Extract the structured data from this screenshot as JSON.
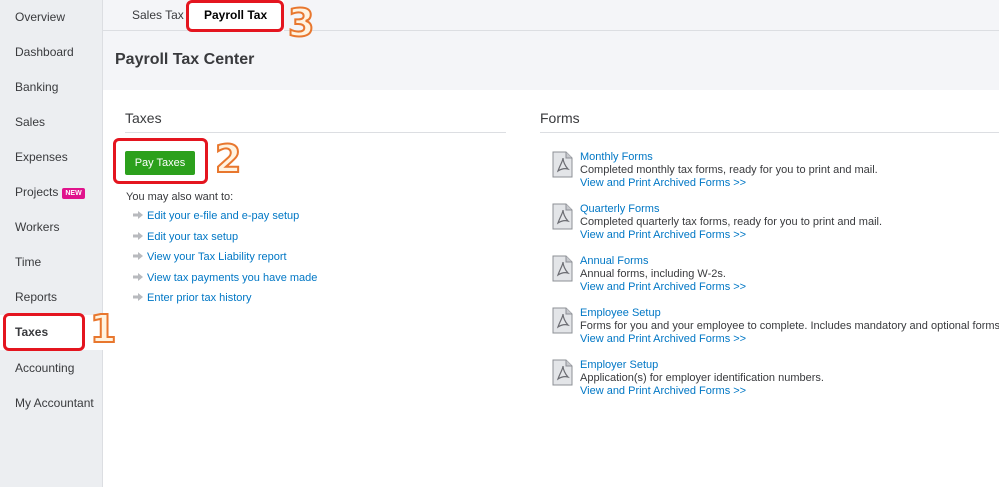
{
  "sidebar": {
    "items": [
      {
        "label": "Overview"
      },
      {
        "label": "Dashboard"
      },
      {
        "label": "Banking"
      },
      {
        "label": "Sales"
      },
      {
        "label": "Expenses"
      },
      {
        "label": "Projects",
        "badge": "NEW"
      },
      {
        "label": "Workers"
      },
      {
        "label": "Time"
      },
      {
        "label": "Reports"
      },
      {
        "label": "Taxes",
        "active": true
      },
      {
        "label": "Accounting"
      },
      {
        "label": "My Accountant"
      }
    ]
  },
  "tabs": [
    {
      "label": "Sales Tax"
    },
    {
      "label": "Payroll Tax",
      "active": true
    }
  ],
  "page": {
    "title": "Payroll Tax Center"
  },
  "taxes": {
    "title": "Taxes",
    "pay_button": "Pay Taxes",
    "also_label": "You may also want to:",
    "links": [
      "Edit your e-file and e-pay setup",
      "Edit your tax setup",
      "View your Tax Liability report",
      "View tax payments you have made",
      "Enter prior tax history"
    ]
  },
  "forms": {
    "title": "Forms",
    "items": [
      {
        "title": "Monthly Forms",
        "desc": "Completed monthly tax forms, ready for you to print and mail.",
        "link": "View and Print Archived Forms >>"
      },
      {
        "title": "Quarterly Forms",
        "desc": "Completed quarterly tax forms, ready for you to print and mail.",
        "link": "View and Print Archived Forms >>"
      },
      {
        "title": "Annual Forms",
        "desc": "Annual forms, including W-2s.",
        "link": "View and Print Archived Forms >>"
      },
      {
        "title": "Employee Setup",
        "desc": "Forms for you and your employee to complete. Includes mandatory and optional forms.",
        "link": "View and Print Archived Forms >>"
      },
      {
        "title": "Employer Setup",
        "desc": "Application(s) for employer identification numbers.",
        "link": "View and Print Archived Forms >>"
      }
    ]
  },
  "annotations": {
    "n1": "1",
    "n2": "2",
    "n3": "3"
  },
  "colors": {
    "accent_green": "#2ca01c",
    "link_blue": "#0077c5",
    "highlight_red": "#e4151f",
    "badge_pink": "#e0138c"
  }
}
